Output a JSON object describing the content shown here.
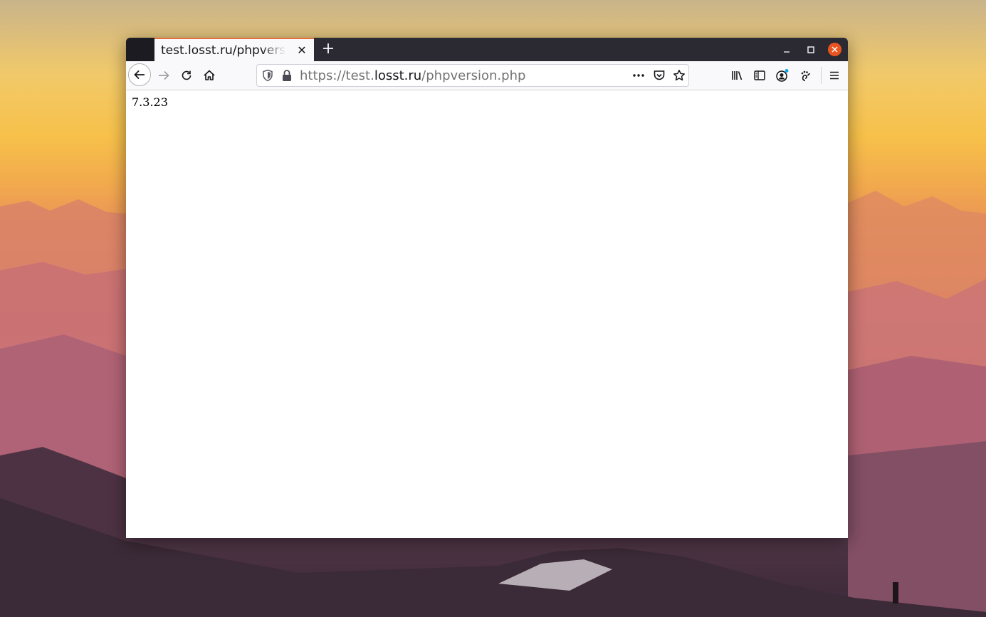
{
  "browser": {
    "tab": {
      "title": "test.losst.ru/phpversion.php"
    },
    "url": {
      "scheme": "https://test.",
      "host": "losst.ru",
      "path": "/phpversion.php"
    }
  },
  "page": {
    "body_text": "7.3.23"
  },
  "icons": {
    "back": "arrow-left-icon",
    "forward": "arrow-right-icon",
    "reload": "reload-icon",
    "home": "home-icon",
    "shield": "tracking-protection-shield-icon",
    "lock": "lock-icon",
    "page_actions": "more-horizontal-icon",
    "pocket": "pocket-icon",
    "bookmark": "star-icon",
    "library": "library-icon",
    "sidebar": "sidebar-icon",
    "account": "account-icon",
    "extension": "gnome-extension-icon",
    "menu": "hamburger-menu-icon"
  },
  "colors": {
    "tab_accent": "#e1703c",
    "close_button": "#e95420",
    "titlebar": "#2b2a33"
  }
}
